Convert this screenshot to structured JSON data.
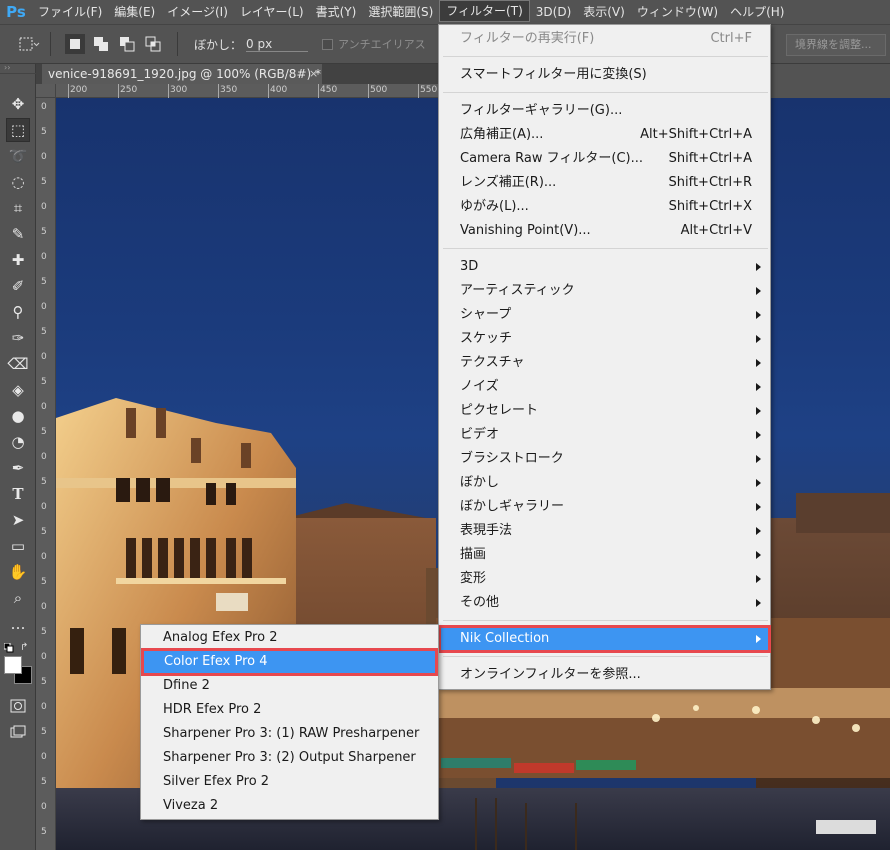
{
  "app": {
    "logo": "Ps"
  },
  "menubar": {
    "items": [
      "ファイル(F)",
      "編集(E)",
      "イメージ(I)",
      "レイヤー(L)",
      "書式(Y)",
      "選択範囲(S)",
      "フィルター(T)",
      "3D(D)",
      "表示(V)",
      "ウィンドウ(W)",
      "ヘルプ(H)"
    ],
    "active_index": 6
  },
  "options": {
    "feather_label": "ぼかし：",
    "feather_value": "0 px",
    "antialias_label": "アンチエイリアス",
    "style_partial": "スタ",
    "refine_edge_label": "境界線を調整..."
  },
  "document": {
    "tab_title": "venice-918691_1920.jpg @ 100% (RGB/8#) *",
    "close_glyph": "×"
  },
  "ruler": {
    "h_ticks": [
      "200",
      "250",
      "300",
      "350",
      "400",
      "450",
      "500",
      "550"
    ],
    "v_ticks": [
      "0",
      "5",
      "0",
      "5",
      "0",
      "5",
      "0",
      "5",
      "0",
      "5",
      "0",
      "5",
      "0",
      "5",
      "0",
      "5",
      "0",
      "5",
      "0",
      "5",
      "0",
      "5",
      "0",
      "5",
      "0",
      "5",
      "0",
      "5",
      "0",
      "5"
    ]
  },
  "filter_menu": {
    "items": [
      {
        "label": "フィルターの再実行(F)",
        "shortcut": "Ctrl+F",
        "disabled": true
      },
      {
        "separator": true
      },
      {
        "label": "スマートフィルター用に変換(S)"
      },
      {
        "separator": true
      },
      {
        "label": "フィルターギャラリー(G)..."
      },
      {
        "label": "広角補正(A)...",
        "shortcut": "Alt+Shift+Ctrl+A"
      },
      {
        "label": "Camera Raw フィルター(C)...",
        "shortcut": "Shift+Ctrl+A"
      },
      {
        "label": "レンズ補正(R)...",
        "shortcut": "Shift+Ctrl+R"
      },
      {
        "label": "ゆがみ(L)...",
        "shortcut": "Shift+Ctrl+X"
      },
      {
        "label": "Vanishing Point(V)...",
        "shortcut": "Alt+Ctrl+V"
      },
      {
        "separator": true
      },
      {
        "label": "3D",
        "submenu": true
      },
      {
        "label": "アーティスティック",
        "submenu": true
      },
      {
        "label": "シャープ",
        "submenu": true
      },
      {
        "label": "スケッチ",
        "submenu": true
      },
      {
        "label": "テクスチャ",
        "submenu": true
      },
      {
        "label": "ノイズ",
        "submenu": true
      },
      {
        "label": "ピクセレート",
        "submenu": true
      },
      {
        "label": "ビデオ",
        "submenu": true
      },
      {
        "label": "ブラシストローク",
        "submenu": true
      },
      {
        "label": "ぼかし",
        "submenu": true
      },
      {
        "label": "ぼかしギャラリー",
        "submenu": true
      },
      {
        "label": "表現手法",
        "submenu": true
      },
      {
        "label": "描画",
        "submenu": true
      },
      {
        "label": "変形",
        "submenu": true
      },
      {
        "label": "その他",
        "submenu": true
      },
      {
        "separator": true
      },
      {
        "label": "Nik Collection",
        "submenu": true,
        "highlight": true
      },
      {
        "separator": true
      },
      {
        "label": "オンラインフィルターを参照..."
      }
    ]
  },
  "nik_submenu": {
    "items": [
      {
        "label": "Analog Efex Pro 2"
      },
      {
        "label": "Color Efex Pro 4",
        "highlight": true
      },
      {
        "label": "Dfine 2"
      },
      {
        "label": "HDR Efex Pro 2"
      },
      {
        "label": "Sharpener Pro 3: (1) RAW Presharpener"
      },
      {
        "label": "Sharpener Pro 3: (2) Output Sharpener"
      },
      {
        "label": "Silver Efex Pro 2"
      },
      {
        "label": "Viveza 2"
      }
    ]
  },
  "tools": [
    "move-icon",
    "marquee-icon",
    "lasso-icon",
    "quick-select-icon",
    "crop-icon",
    "eyedropper-icon",
    "healing-brush-icon",
    "brush-icon",
    "clone-stamp-icon",
    "history-brush-icon",
    "eraser-icon",
    "paint-bucket-icon",
    "blur-icon",
    "dodge-icon",
    "pen-icon",
    "type-icon",
    "path-select-icon",
    "rectangle-icon",
    "hand-icon",
    "zoom-icon",
    "more-tools-icon"
  ],
  "colors": {
    "menu_highlight": "#3d95f2",
    "annotation_outline": "#e7484e",
    "ps_blue": "#3fa9f5"
  }
}
